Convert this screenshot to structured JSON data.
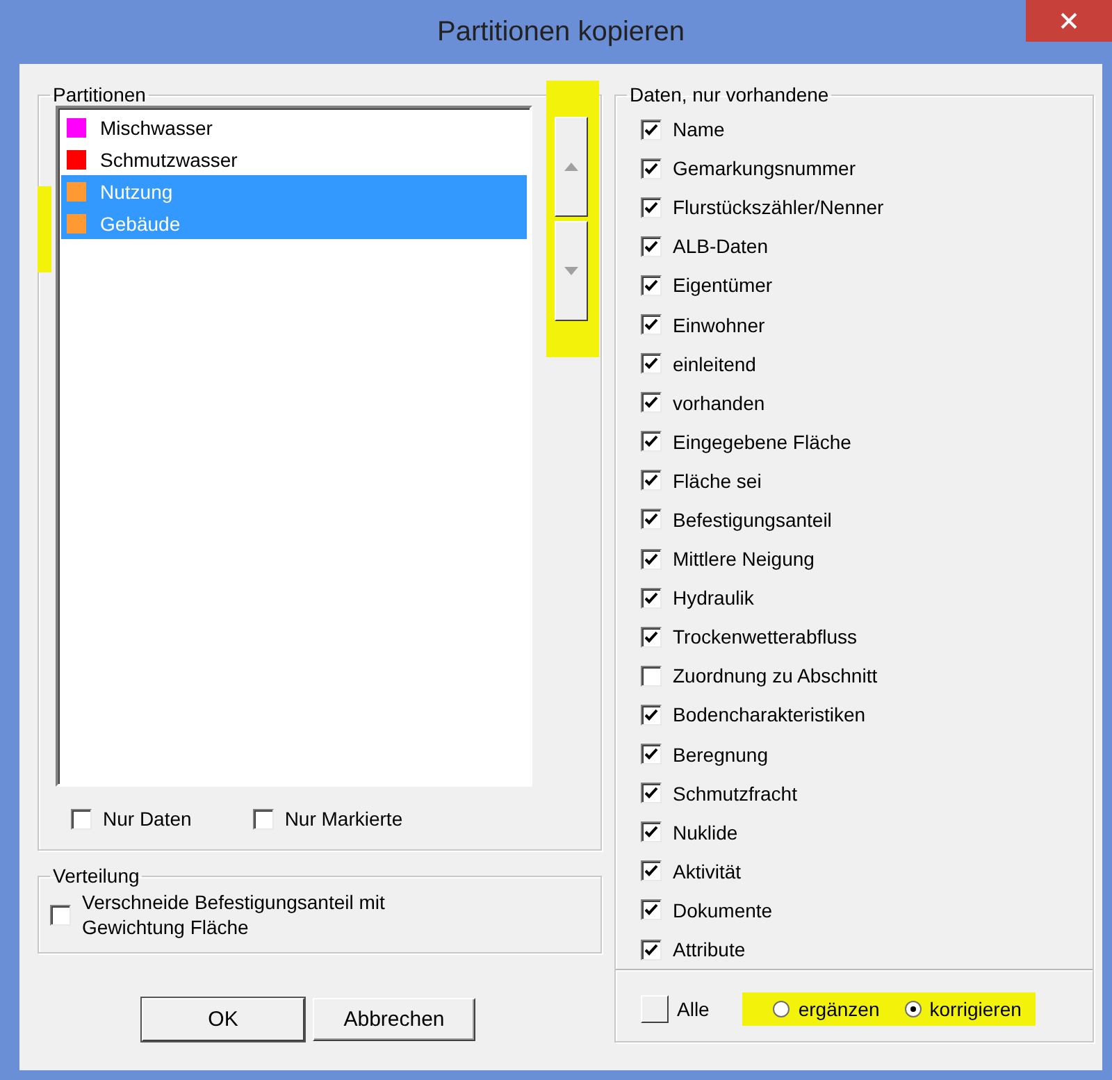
{
  "window": {
    "title": "Partitionen kopieren"
  },
  "partitions": {
    "legend": "Partitionen",
    "items": [
      {
        "label": "Mischwasser",
        "color": "#ff00ff",
        "selected": false
      },
      {
        "label": "Schmutzwasser",
        "color": "#ff0000",
        "selected": false
      },
      {
        "label": "Nutzung",
        "color": "#ff9933",
        "selected": true
      },
      {
        "label": "Gebäude",
        "color": "#ff9933",
        "selected": true
      }
    ],
    "options": [
      {
        "label": "Nur Daten",
        "checked": false
      },
      {
        "label": "Nur Markierte",
        "checked": false
      }
    ]
  },
  "distribution": {
    "legend": "Verteilung",
    "option": {
      "label": "Verschneide Befestigungsanteil mit Gewichtung Fläche",
      "checked": false
    }
  },
  "buttons": [
    {
      "label": "OK",
      "default": true
    },
    {
      "label": "Abbrechen",
      "default": false
    }
  ],
  "data": {
    "legend": "Daten, nur vorhandene",
    "fields": [
      {
        "label": "Name",
        "checked": true
      },
      {
        "label": "Gemarkungsnummer",
        "checked": true
      },
      {
        "label": "Flurstückszähler/Nenner",
        "checked": true
      },
      {
        "label": "ALB-Daten",
        "checked": true
      },
      {
        "label": "Eigentümer",
        "checked": true
      },
      {
        "label": "Einwohner",
        "checked": true
      },
      {
        "label": "einleitend",
        "checked": true
      },
      {
        "label": "vorhanden",
        "checked": true
      },
      {
        "label": "Eingegebene Fläche",
        "checked": true
      },
      {
        "label": "Fläche sei",
        "checked": true
      },
      {
        "label": "Befestigungsanteil",
        "checked": true
      },
      {
        "label": "Mittlere Neigung",
        "checked": true
      },
      {
        "label": "Hydraulik",
        "checked": true
      },
      {
        "label": "Trockenwetterabfluss",
        "checked": true
      },
      {
        "label": "Zuordnung zu Abschnitt",
        "checked": false
      },
      {
        "label": "Bodencharakteristiken",
        "checked": true
      },
      {
        "label": "Beregnung",
        "checked": true
      },
      {
        "label": "Schmutzfracht",
        "checked": true
      },
      {
        "label": "Nuklide",
        "checked": true
      },
      {
        "label": "Aktivität",
        "checked": true
      },
      {
        "label": "Dokumente",
        "checked": true
      },
      {
        "label": "Attribute",
        "checked": true
      }
    ],
    "all": {
      "label": "Alle",
      "checked": false
    },
    "modes": [
      {
        "label": "ergänzen",
        "selected": false
      },
      {
        "label": "korrigieren",
        "selected": true
      }
    ]
  }
}
